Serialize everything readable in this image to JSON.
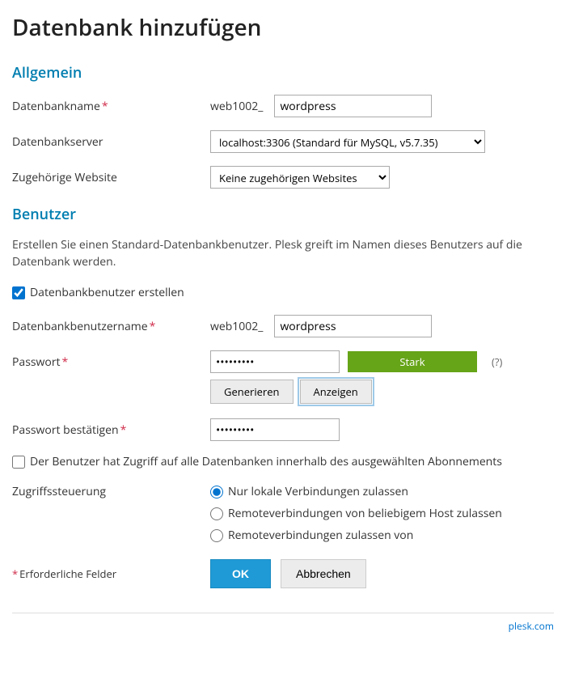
{
  "page_title": "Datenbank hinzufügen",
  "sections": {
    "general": {
      "heading": "Allgemein",
      "db_name_label": "Datenbankname",
      "db_name_prefix": "web1002_",
      "db_name_value": "wordpress",
      "db_server_label": "Datenbankserver",
      "db_server_value": "localhost:3306 (Standard für MySQL, v5.7.35)",
      "related_site_label": "Zugehörige Website",
      "related_site_value": "Keine zugehörigen Websites"
    },
    "user": {
      "heading": "Benutzer",
      "description": "Erstellen Sie einen Standard-Datenbankbenutzer. Plesk greift im Namen dieses Benutzers auf die Datenbank werden.",
      "create_user_label": "Datenbankbenutzer erstellen",
      "create_user_checked": true,
      "username_label": "Datenbankbenutzername",
      "username_prefix": "web1002_",
      "username_value": "wordpress",
      "password_label": "Passwort",
      "password_value": "•••••••••",
      "strength_label": "Stark",
      "help_label": "(?)",
      "generate_label": "Generieren",
      "show_label": "Anzeigen",
      "confirm_password_label": "Passwort bestätigen",
      "confirm_password_value": "•••••••••",
      "all_db_access_label": "Der Benutzer hat Zugriff auf alle Datenbanken innerhalb des ausgewählten Abonnements",
      "access_control_label": "Zugriffssteuerung",
      "access_options": {
        "local": "Nur lokale Verbindungen zulassen",
        "remote_any": "Remoteverbindungen von beliebigem Host zulassen",
        "remote_from": "Remoteverbindungen zulassen von"
      }
    }
  },
  "required_note": "Erforderliche Felder",
  "required_asterisk": "*",
  "buttons": {
    "ok": "OK",
    "cancel": "Abbrechen"
  },
  "footer_link": "plesk.com"
}
